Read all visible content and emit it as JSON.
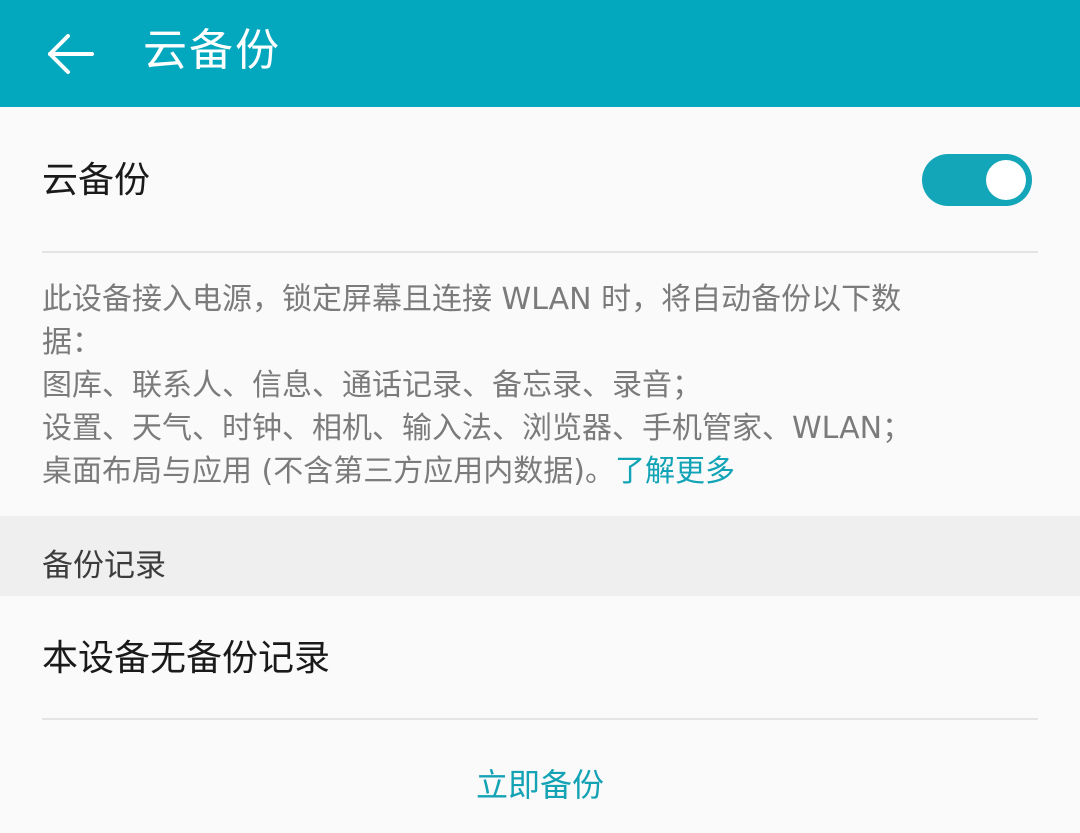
{
  "appbar": {
    "title": "云备份",
    "back_icon": "arrow-left-icon",
    "background_color": "#03a7be"
  },
  "toggle_row": {
    "label": "云备份",
    "state": "on",
    "accent_color": "#12a6b8"
  },
  "description": {
    "line1": "此设备接入电源，锁定屏幕且连接 WLAN 时，将自动备份以下数",
    "line2": "据：",
    "line3": "图库、联系人、信息、通话记录、备忘录、录音；",
    "line4": "设置、天气、时钟、相机、输入法、浏览器、手机管家、WLAN；",
    "line5": "桌面布局与应用 (不含第三方应用内数据)。",
    "learn_more": "了解更多"
  },
  "backup_records": {
    "section_title": "备份记录",
    "empty_text": "本设备无备份记录"
  },
  "actions": {
    "backup_now": "立即备份"
  }
}
